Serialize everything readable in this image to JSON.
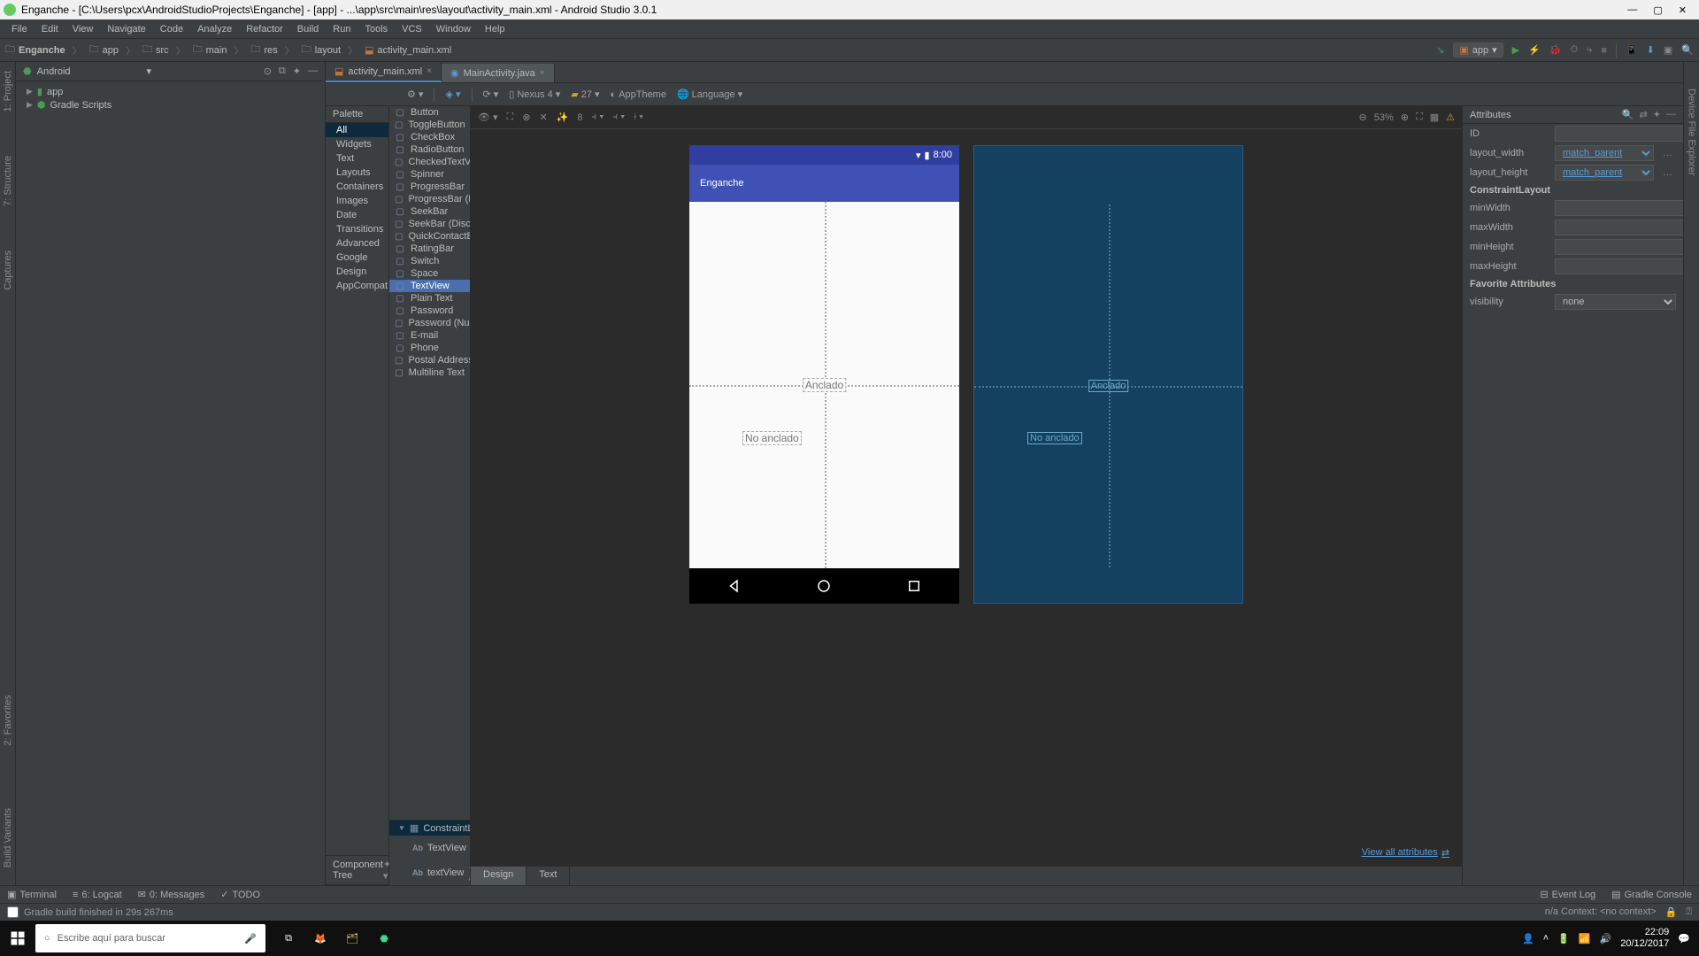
{
  "window": {
    "title": "Enganche - [C:\\Users\\pcx\\AndroidStudioProjects\\Enganche] - [app] - ...\\app\\src\\main\\res\\layout\\activity_main.xml - Android Studio 3.0.1"
  },
  "menu": [
    "File",
    "Edit",
    "View",
    "Navigate",
    "Code",
    "Analyze",
    "Refactor",
    "Build",
    "Run",
    "Tools",
    "VCS",
    "Window",
    "Help"
  ],
  "breadcrumb": [
    "Enganche",
    "app",
    "src",
    "main",
    "res",
    "layout",
    "activity_main.xml"
  ],
  "runConfig": "app",
  "project": {
    "label": "Android",
    "items": [
      {
        "label": "app",
        "indent": 0
      },
      {
        "label": "Gradle Scripts",
        "indent": 0
      }
    ]
  },
  "editorTabs": [
    {
      "label": "activity_main.xml",
      "active": true,
      "icon": "xml"
    },
    {
      "label": "MainActivity.java",
      "active": false,
      "icon": "java"
    }
  ],
  "designToolbar": {
    "device": "Nexus 4",
    "api": "27",
    "theme": "AppTheme",
    "language": "Language"
  },
  "palette": {
    "title": "Palette",
    "categories": [
      "All",
      "Widgets",
      "Text",
      "Layouts",
      "Containers",
      "Images",
      "Date",
      "Transitions",
      "Advanced",
      "Google",
      "Design",
      "AppCompat"
    ],
    "selected": "All",
    "widgets": [
      "Button",
      "ToggleButton",
      "CheckBox",
      "RadioButton",
      "CheckedTextView",
      "Spinner",
      "ProgressBar",
      "ProgressBar (Horizontal)",
      "SeekBar",
      "SeekBar (Discrete)",
      "QuickContactBadge",
      "RatingBar",
      "Switch",
      "Space",
      "TextView",
      "Plain Text",
      "Password",
      "Password (Numeric)",
      "E-mail",
      "Phone",
      "Postal Address",
      "Multiline Text"
    ],
    "widgetSelected": "TextView"
  },
  "componentTree": {
    "title": "Component Tree",
    "root": "ConstraintLayout",
    "children": [
      {
        "name": "TextView",
        "text": "\"Anclado\"",
        "flag": "warn"
      },
      {
        "name": "textView",
        "text": "\"No anclado\"",
        "flag": "err"
      }
    ]
  },
  "preview": {
    "time": "8:00",
    "appTitle": "Enganche",
    "tv1": "Anclado",
    "tv2": "No anclado"
  },
  "zoom": "53%",
  "attributes": {
    "title": "Attributes",
    "id": "",
    "layout_width": "match_parent",
    "layout_height": "match_parent",
    "sectionCL": "ConstraintLayout",
    "minWidth": "",
    "maxWidth": "",
    "minHeight": "",
    "maxHeight": "",
    "sectionFav": "Favorite Attributes",
    "visibility": "none",
    "viewAll": "View all attributes"
  },
  "designTextTabs": [
    "Design",
    "Text"
  ],
  "bottomPanels": [
    {
      "label": "Terminal",
      "icon": "▣"
    },
    {
      "label": "6: Logcat",
      "icon": "≡"
    },
    {
      "label": "0: Messages",
      "icon": "✉"
    },
    {
      "label": "TODO",
      "icon": "✓"
    }
  ],
  "bottomRight": [
    {
      "label": "Event Log",
      "icon": "⊟"
    },
    {
      "label": "Gradle Console",
      "icon": "▤"
    }
  ],
  "statusBar": {
    "msg": "Gradle build finished in 29s 267ms",
    "right": "n/a   Context: <no context>"
  },
  "leftGutter": [
    "1: Project",
    "7: Structure",
    "Captures"
  ],
  "leftGutterBottom": [
    "Build Variants",
    "2: Favorites"
  ],
  "rightGutter": [
    "Device File Explorer"
  ],
  "taskbar": {
    "searchPlaceholder": "Escribe aquí para buscar",
    "time": "22:09",
    "date": "20/12/2017"
  }
}
